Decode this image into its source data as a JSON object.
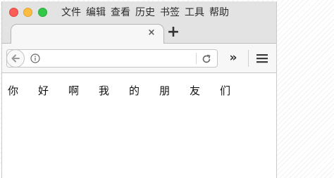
{
  "menu": {
    "items": [
      "文件",
      "编辑",
      "查看",
      "历史",
      "书签",
      "工具",
      "帮助"
    ]
  },
  "tabs": {
    "close_symbol": "×",
    "new_tab_symbol": "+"
  },
  "navbar": {
    "url_value": "",
    "url_placeholder": "",
    "overflow_symbol": "»",
    "icons": {
      "back": "back-arrow-icon",
      "info": "info-icon",
      "reload": "reload-icon",
      "menu": "hamburger-menu-icon"
    }
  },
  "content": {
    "text": "你好啊我的朋友们"
  },
  "colors": {
    "close": "#fc5d57",
    "minimize": "#fdbc40",
    "maximize": "#34c84a",
    "chrome": "#e3e3e3",
    "toolbar": "#f7f7f7"
  }
}
